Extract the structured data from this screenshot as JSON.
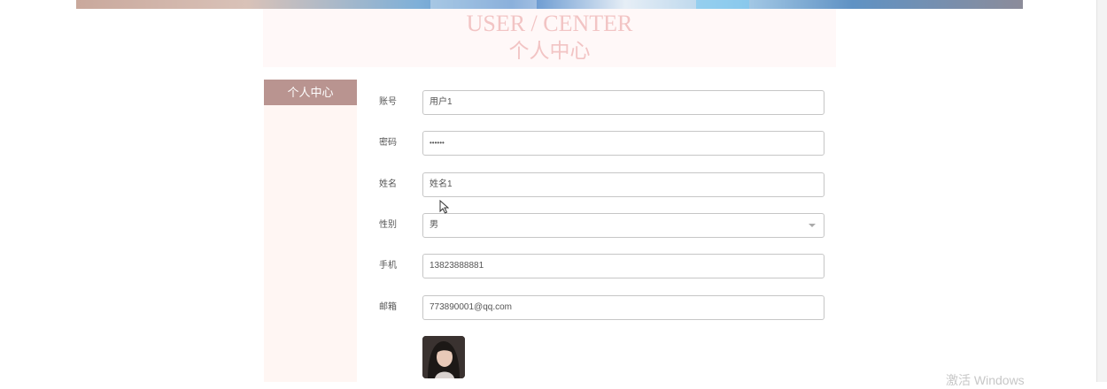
{
  "header": {
    "title_en": "USER / CENTER",
    "title_cn": "个人中心"
  },
  "sidebar": {
    "items": [
      {
        "label": "个人中心",
        "active": true
      }
    ]
  },
  "form": {
    "account": {
      "label": "账号",
      "value": "用户1"
    },
    "password": {
      "label": "密码",
      "value": "••••••"
    },
    "name": {
      "label": "姓名",
      "value": "姓名1"
    },
    "gender": {
      "label": "性别",
      "value": "男"
    },
    "phone": {
      "label": "手机",
      "value": "13823888881"
    },
    "email": {
      "label": "邮箱",
      "value": "773890001@qq.com"
    }
  },
  "watermark": "激活 Windows",
  "colors": {
    "accent": "#b99490",
    "sidebar_bg": "#fff6f3",
    "title_color": "#f2c4c4"
  }
}
